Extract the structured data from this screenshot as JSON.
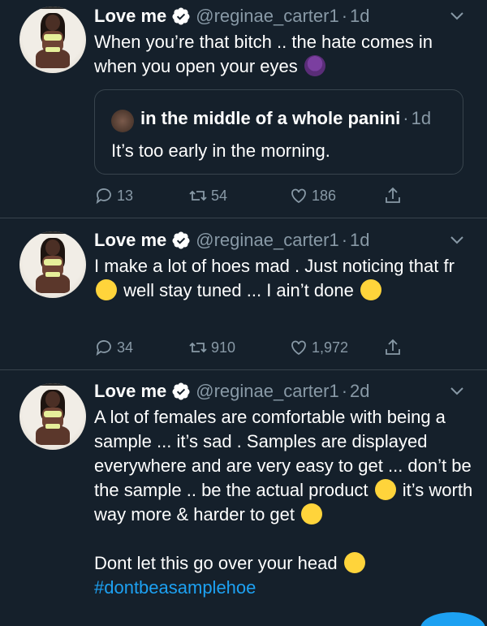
{
  "tweets": [
    {
      "name": "Love me",
      "handle": "@reginae_carter1",
      "dot": "·",
      "time": "1d",
      "text": "When you’re that bitch .. the hate comes in when you open your eyes",
      "text_emoji": "woman-shrugging-emoji",
      "quote": {
        "name": "in the middle of a whole panini",
        "dot": "·",
        "time": "1d",
        "text": "It’s too early in the morning."
      },
      "replies": "13",
      "retweets": "54",
      "likes": "186"
    },
    {
      "name": "Love me",
      "handle": "@reginae_carter1",
      "dot": "·",
      "time": "1d",
      "text_a": "I make a lot of hoes mad . Just noticing that fr",
      "text_b": "well stay tuned ... I ain’t done",
      "replies": "34",
      "retweets": "910",
      "likes": "1,972"
    },
    {
      "name": "Love me",
      "handle": "@reginae_carter1",
      "dot": "·",
      "time": "2d",
      "text_a": "A lot of females are comfortable with being a sample ... it’s sad . Samples are displayed everywhere and are very easy to get ... don’t be the sample .. be the actual product",
      "text_b": "it’s worth way more & harder to get",
      "text_c": "Dont let this go over your head",
      "hashtag": "#dontbeasamplehoe"
    }
  ],
  "colors": {
    "background": "#15202b",
    "divider": "#38444d",
    "secondary_text": "#8899a6",
    "accent": "#1da1f2"
  },
  "icons": {
    "verified": "verified-badge-icon",
    "more": "chevron-down-icon",
    "reply": "reply-icon",
    "retweet": "retweet-icon",
    "like": "heart-icon",
    "share": "share-icon"
  }
}
